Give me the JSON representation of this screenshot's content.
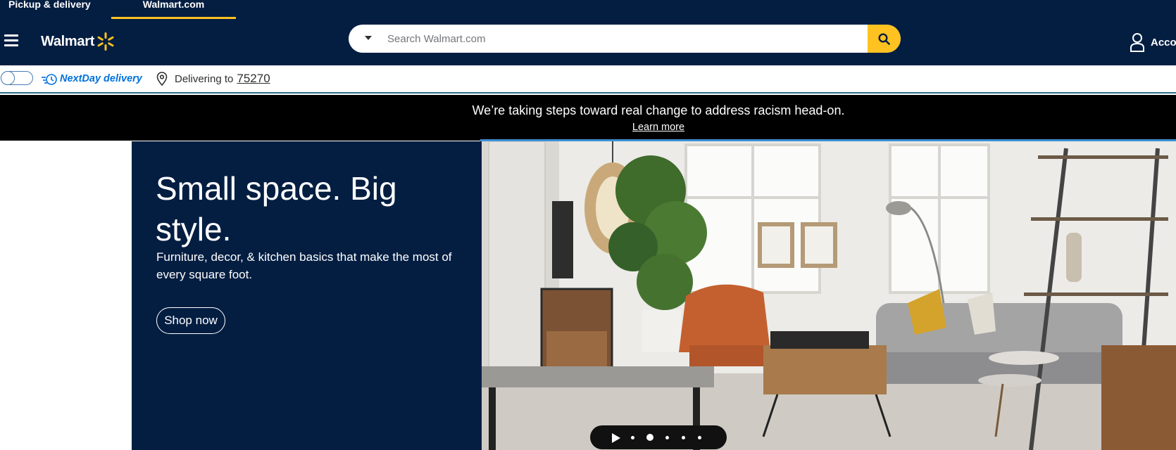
{
  "header": {
    "tabs": [
      {
        "label": "Pickup & delivery",
        "active": false
      },
      {
        "label": "Walmart.com",
        "active": true
      }
    ],
    "logo_text": "Walmart",
    "search": {
      "placeholder": "Search Walmart.com"
    },
    "account_label": "Acco"
  },
  "delivery_bar": {
    "nextday_label": "NextDay delivery",
    "delivering_label": "Delivering to",
    "zip": "75270"
  },
  "banner": {
    "message": "We’re taking steps toward real change to address racism head-on.",
    "link": "Learn more"
  },
  "hero": {
    "title": "Small space. Big style.",
    "subtitle": "Furniture, decor, & kitchen basics that make the most of every square foot.",
    "cta": "Shop now",
    "carousel": {
      "slides": 5,
      "active_index": 1
    }
  },
  "colors": {
    "navy": "#041e42",
    "spark_yellow": "#ffc220",
    "link_blue": "#0071dc",
    "banner_black": "#000000"
  },
  "icons": [
    "hamburger-icon",
    "spark-icon",
    "chevron-down-icon",
    "search-icon",
    "account-icon",
    "nextday-icon",
    "location-pin-icon",
    "play-icon"
  ]
}
